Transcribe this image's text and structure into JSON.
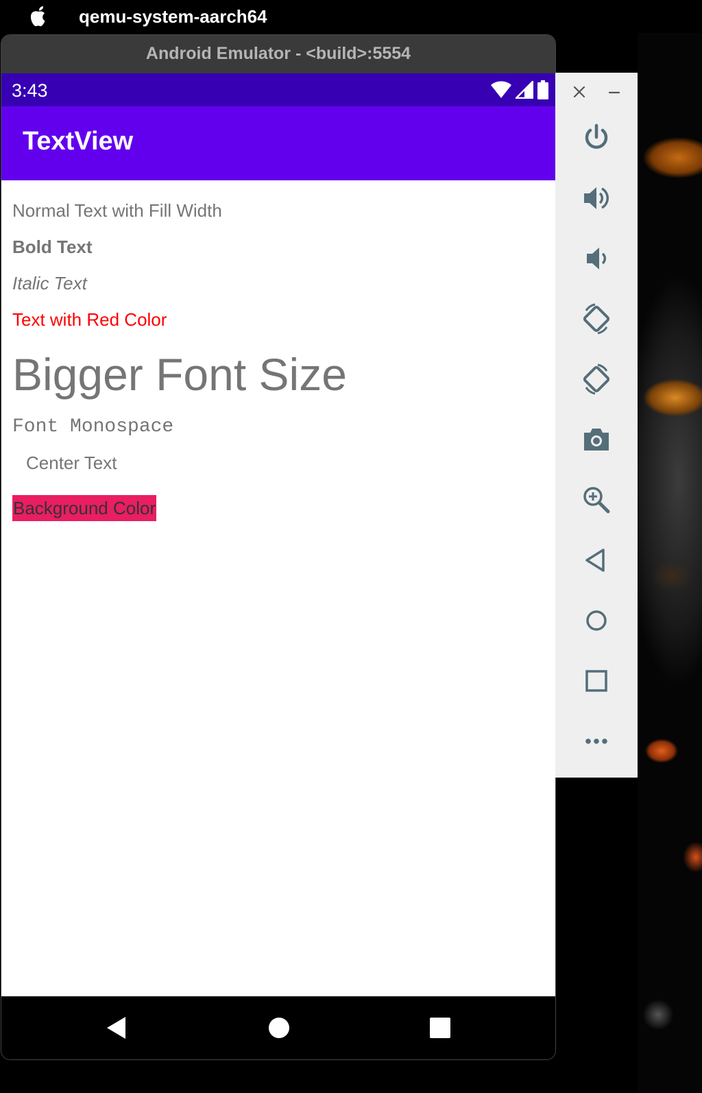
{
  "menubar": {
    "app_name": "qemu-system-aarch64"
  },
  "window": {
    "title": "Android Emulator - <build>:5554"
  },
  "status_bar": {
    "time": "3:43",
    "icons": [
      "wifi-icon",
      "signal-icon",
      "battery-icon"
    ]
  },
  "app_bar": {
    "title": "TextView"
  },
  "content": {
    "normal_text": "Normal Text with Fill Width",
    "bold_text": "Bold Text",
    "italic_text": "Italic Text",
    "red_text": "Text with Red Color",
    "big_text": "Bigger Font Size",
    "mono_text": "Font Monospace",
    "center_text": "Center Text",
    "bg_text": "Background Color"
  },
  "nav_bar": {
    "buttons": [
      "back-icon",
      "home-icon",
      "recents-icon"
    ]
  },
  "side_toolbar": {
    "window_controls": [
      "close-icon",
      "minimize-icon"
    ],
    "buttons": [
      "power-icon",
      "volume-up-icon",
      "volume-down-icon",
      "rotate-left-icon",
      "rotate-right-icon",
      "camera-icon",
      "zoom-icon",
      "back-icon",
      "home-icon",
      "overview-icon",
      "more-icon"
    ]
  },
  "colors": {
    "status_bar": "#3700b3",
    "app_bar": "#6200ee",
    "text_gray": "#757575",
    "text_red": "#ff0000",
    "text_background": "#e91e63",
    "toolbar_icon": "#546e7a"
  }
}
